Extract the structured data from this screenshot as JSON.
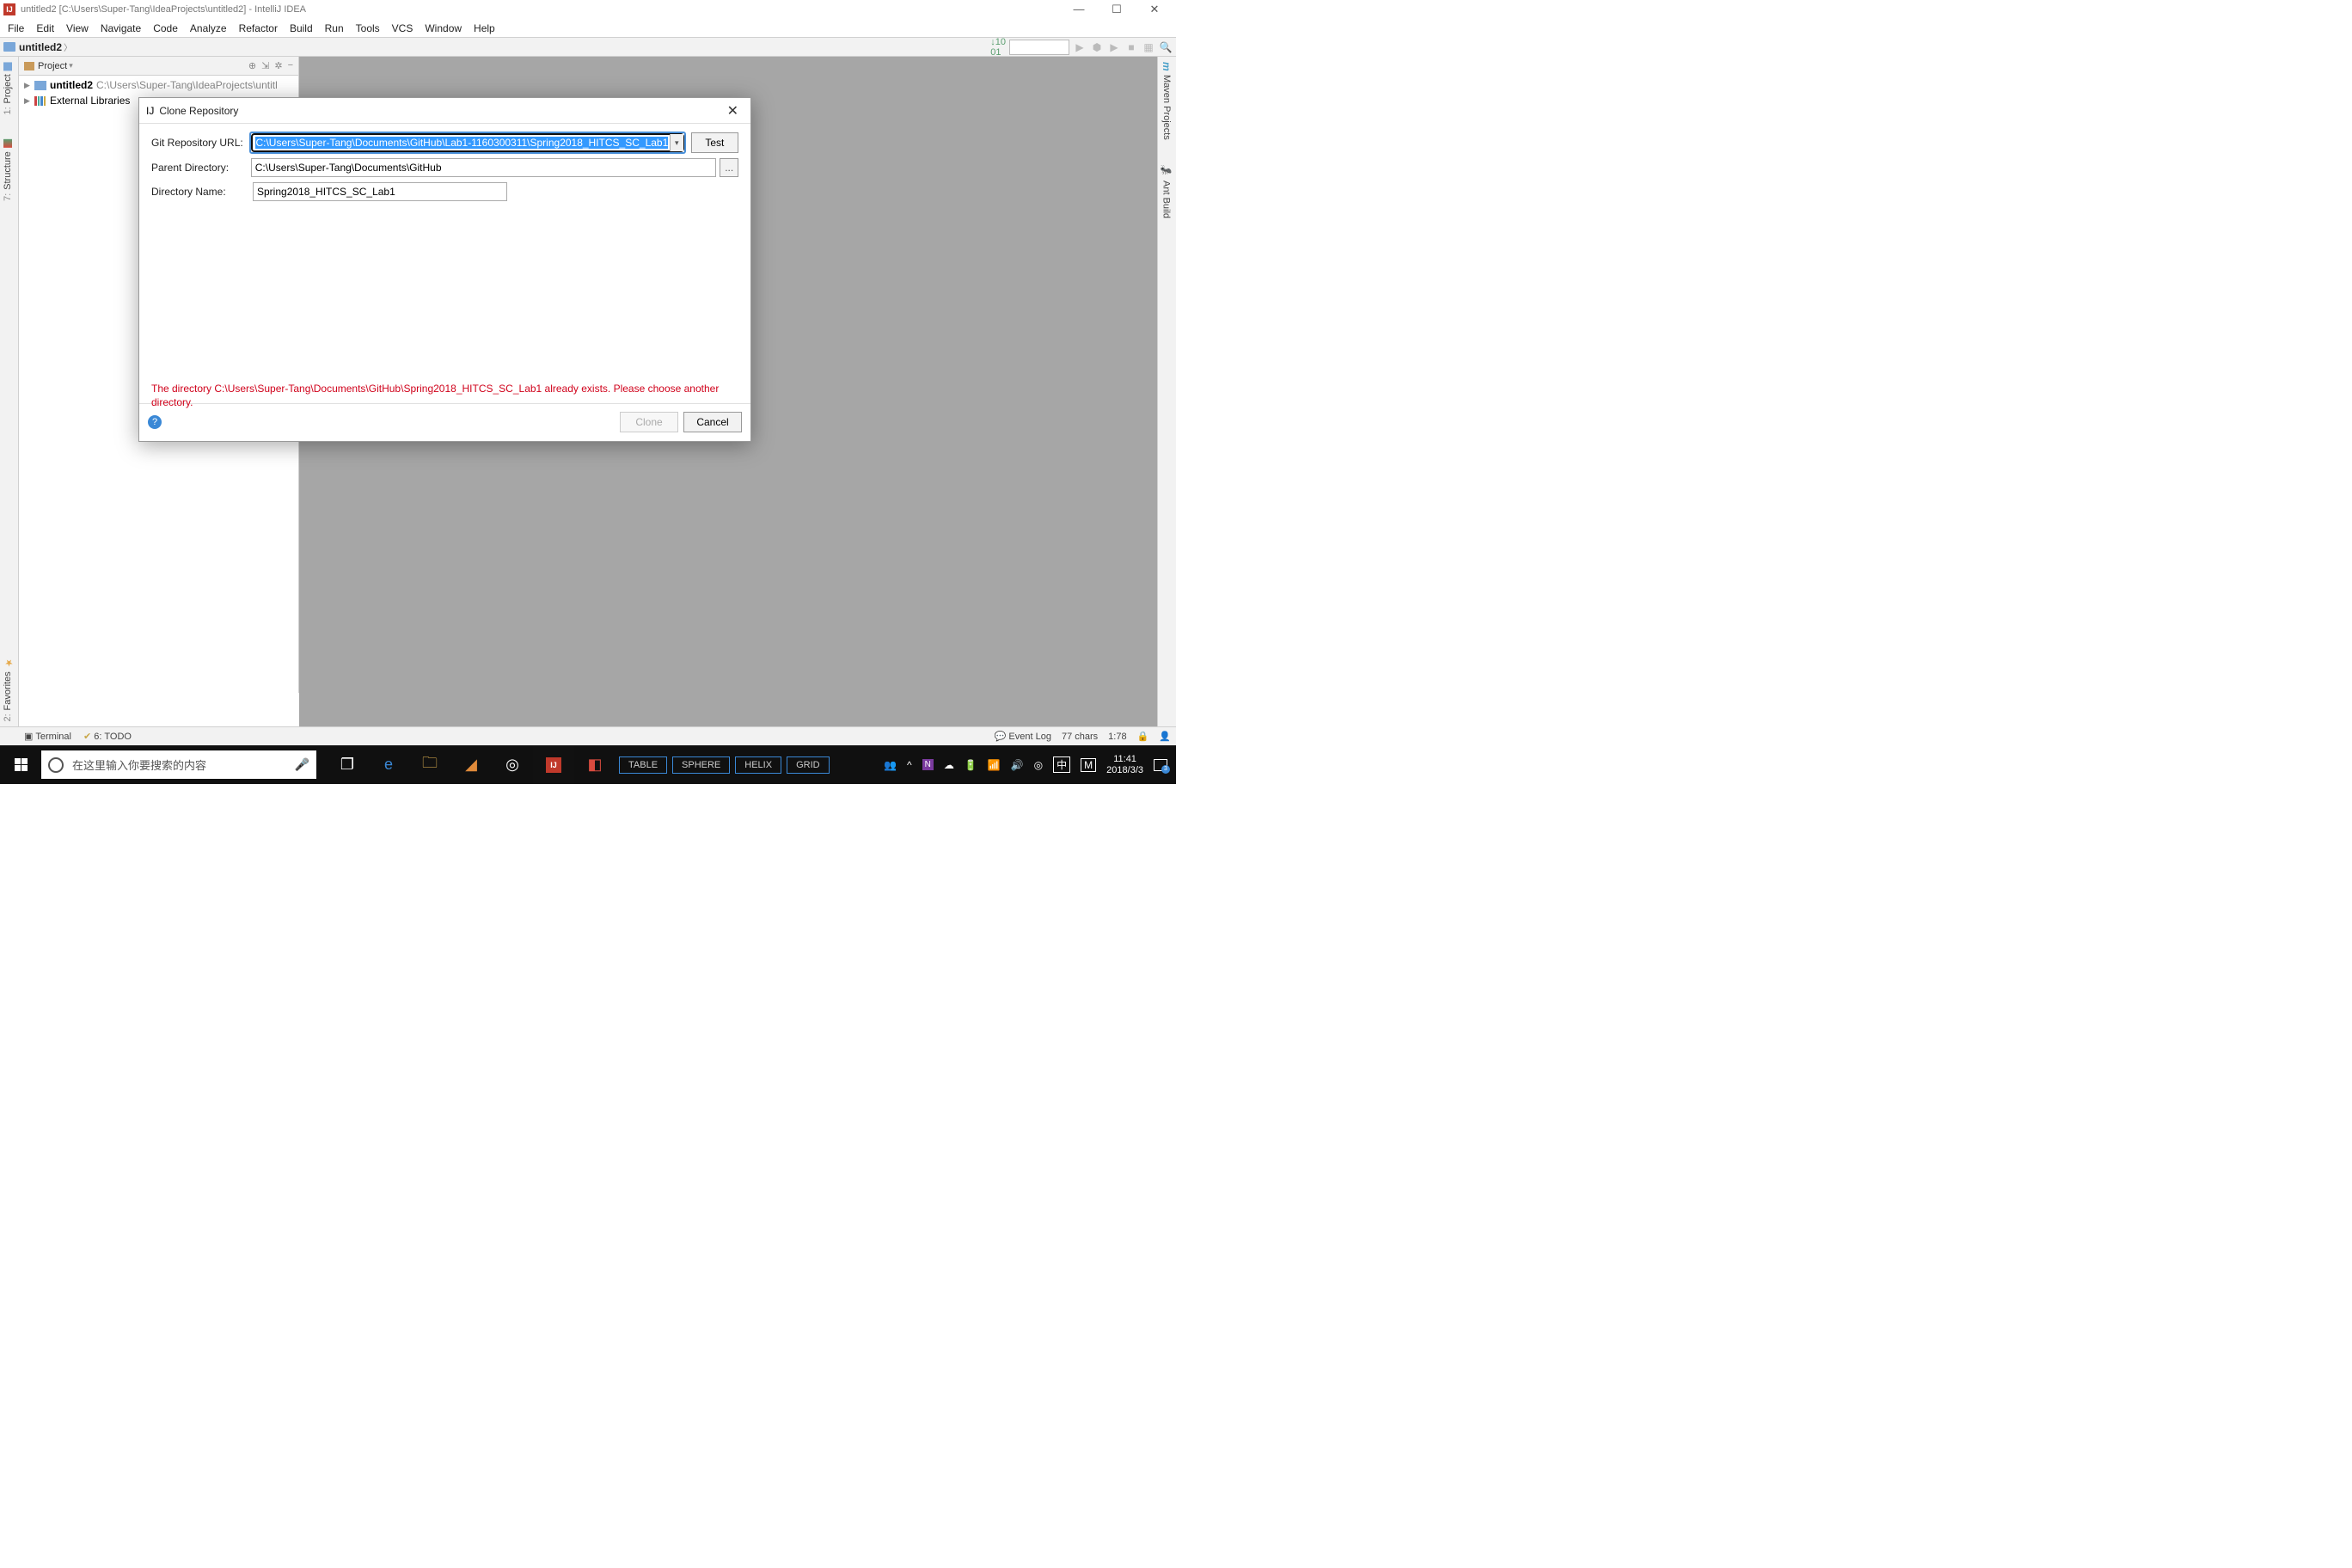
{
  "window": {
    "title": "untitled2 [C:\\Users\\Super-Tang\\IdeaProjects\\untitled2] - IntelliJ IDEA",
    "controls": {
      "minimize": "—",
      "maximize": "☐",
      "close": "✕"
    }
  },
  "menu": {
    "items": [
      "File",
      "Edit",
      "View",
      "Navigate",
      "Code",
      "Analyze",
      "Refactor",
      "Build",
      "Run",
      "Tools",
      "VCS",
      "Window",
      "Help"
    ]
  },
  "breadcrumb": {
    "root": "untitled2"
  },
  "left_tabs": {
    "project": {
      "num": "1:",
      "label": "Project"
    },
    "structure": {
      "num": "7:",
      "label": "Structure"
    },
    "favorites": {
      "num": "2:",
      "label": "Favorites"
    }
  },
  "right_tabs": {
    "maven": "Maven Projects",
    "ant": "Ant Build"
  },
  "project_tw": {
    "header": "Project",
    "rows": [
      {
        "name": "untitled2",
        "path": "C:\\Users\\Super-Tang\\IdeaProjects\\untitl"
      },
      {
        "name": "External Libraries"
      }
    ]
  },
  "dialog": {
    "title": "Clone Repository",
    "labels": {
      "url": "Git Repository URL:",
      "parent": "Parent Directory:",
      "dirname": "Directory Name:"
    },
    "values": {
      "url": "C:\\Users\\Super-Tang\\Documents\\GitHub\\Lab1-1160300311\\Spring2018_HITCS_SC_Lab1",
      "parent": "C:\\Users\\Super-Tang\\Documents\\GitHub",
      "dirname": "Spring2018_HITCS_SC_Lab1"
    },
    "test_label": "Test",
    "browse_label": "...",
    "error": "The directory C:\\Users\\Super-Tang\\Documents\\GitHub\\Spring2018_HITCS_SC_Lab1 already exists. Please choose another directory.",
    "buttons": {
      "clone": "Clone",
      "cancel": "Cancel"
    },
    "help": "?"
  },
  "statusbar": {
    "terminal": "Terminal",
    "todo_num": "6:",
    "todo": "TODO",
    "event_log": "Event Log",
    "chars": "77 chars",
    "pos": "1:78"
  },
  "taskbar": {
    "search_placeholder": "在这里输入你要搜索的内容",
    "matlab_tabs": [
      "TABLE",
      "SPHERE",
      "HELIX",
      "GRID"
    ],
    "tray": {
      "ime1": "中",
      "ime2": "M",
      "time": "11:41",
      "date": "2018/3/3",
      "notif_count": "3"
    }
  }
}
